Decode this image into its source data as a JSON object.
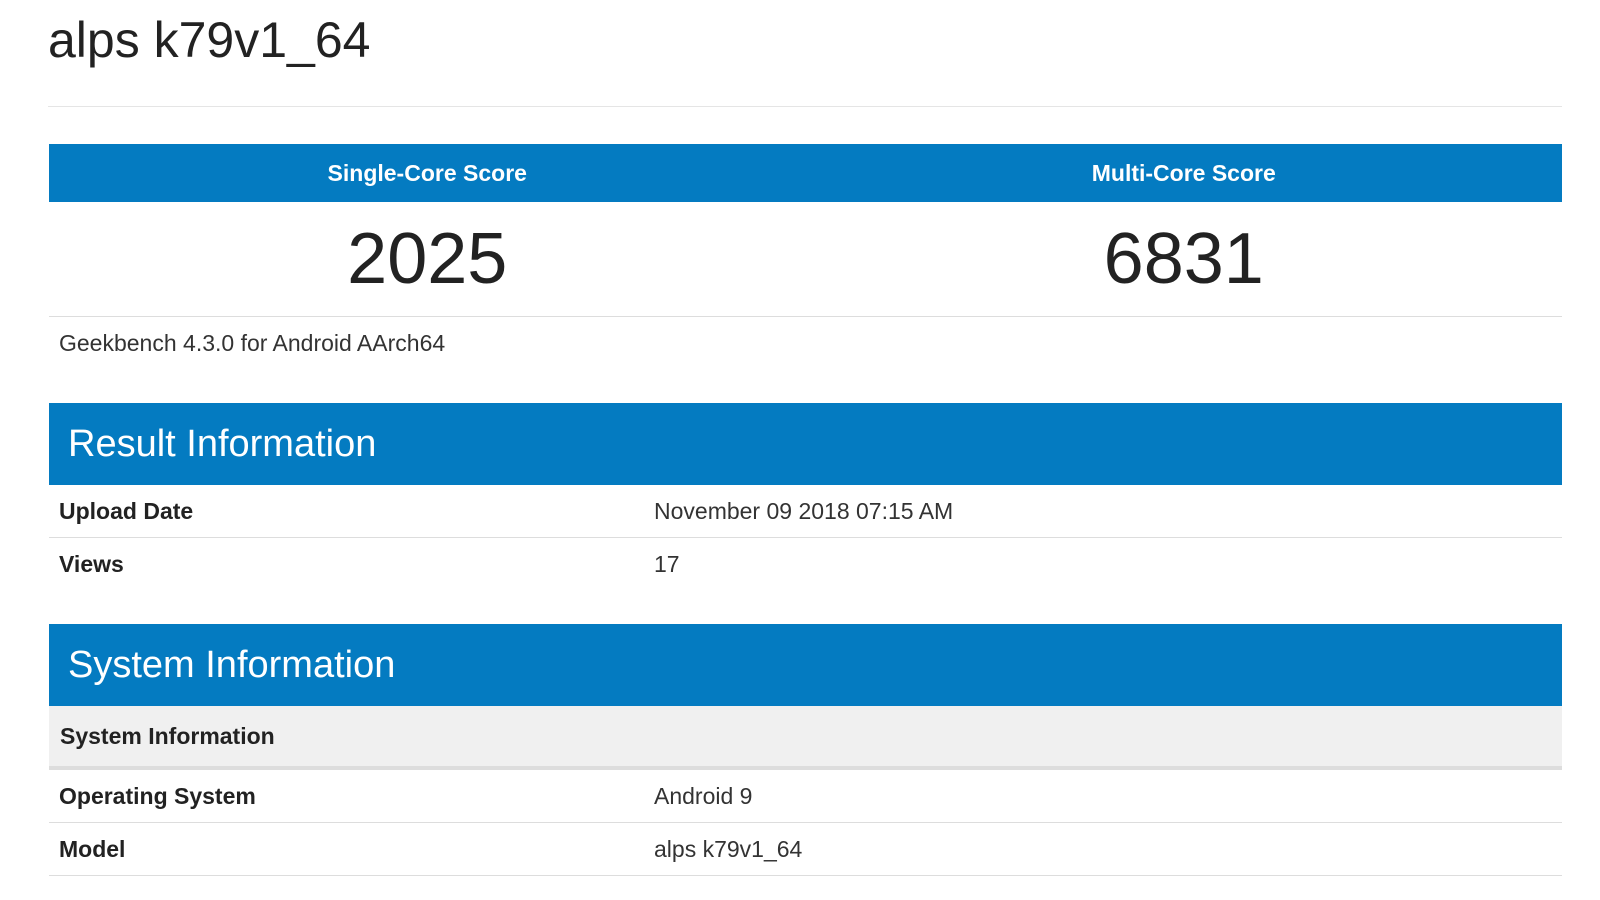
{
  "page": {
    "title": "alps k79v1_64"
  },
  "scores": {
    "single_core_label": "Single-Core Score",
    "multi_core_label": "Multi-Core Score",
    "single_core_value": "2025",
    "multi_core_value": "6831",
    "benchmark_caption": "Geekbench 4.3.0 for Android AArch64"
  },
  "result_information": {
    "header": "Result Information",
    "rows": [
      {
        "key": "Upload Date",
        "value": "November 09 2018 07:15 AM"
      },
      {
        "key": "Views",
        "value": "17"
      }
    ]
  },
  "system_information": {
    "header": "System Information",
    "subheader": "System Information",
    "rows": [
      {
        "key": "Operating System",
        "value": "Android 9"
      },
      {
        "key": "Model",
        "value": "alps k79v1_64"
      }
    ]
  },
  "colors": {
    "accent": "#047bc1",
    "subheader_bg": "#f0f0f0"
  }
}
